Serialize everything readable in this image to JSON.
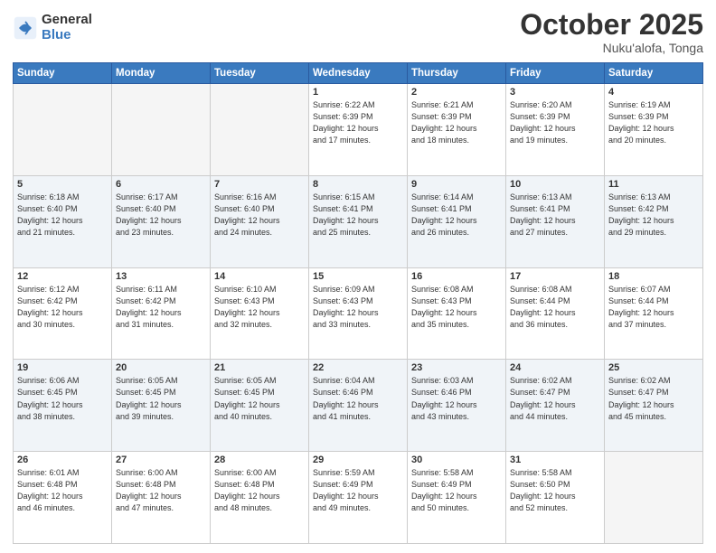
{
  "logo": {
    "general": "General",
    "blue": "Blue"
  },
  "title": "October 2025",
  "location": "Nuku'alofa, Tonga",
  "weekdays": [
    "Sunday",
    "Monday",
    "Tuesday",
    "Wednesday",
    "Thursday",
    "Friday",
    "Saturday"
  ],
  "weeks": [
    [
      {
        "day": "",
        "info": ""
      },
      {
        "day": "",
        "info": ""
      },
      {
        "day": "",
        "info": ""
      },
      {
        "day": "1",
        "info": "Sunrise: 6:22 AM\nSunset: 6:39 PM\nDaylight: 12 hours\nand 17 minutes."
      },
      {
        "day": "2",
        "info": "Sunrise: 6:21 AM\nSunset: 6:39 PM\nDaylight: 12 hours\nand 18 minutes."
      },
      {
        "day": "3",
        "info": "Sunrise: 6:20 AM\nSunset: 6:39 PM\nDaylight: 12 hours\nand 19 minutes."
      },
      {
        "day": "4",
        "info": "Sunrise: 6:19 AM\nSunset: 6:39 PM\nDaylight: 12 hours\nand 20 minutes."
      }
    ],
    [
      {
        "day": "5",
        "info": "Sunrise: 6:18 AM\nSunset: 6:40 PM\nDaylight: 12 hours\nand 21 minutes."
      },
      {
        "day": "6",
        "info": "Sunrise: 6:17 AM\nSunset: 6:40 PM\nDaylight: 12 hours\nand 23 minutes."
      },
      {
        "day": "7",
        "info": "Sunrise: 6:16 AM\nSunset: 6:40 PM\nDaylight: 12 hours\nand 24 minutes."
      },
      {
        "day": "8",
        "info": "Sunrise: 6:15 AM\nSunset: 6:41 PM\nDaylight: 12 hours\nand 25 minutes."
      },
      {
        "day": "9",
        "info": "Sunrise: 6:14 AM\nSunset: 6:41 PM\nDaylight: 12 hours\nand 26 minutes."
      },
      {
        "day": "10",
        "info": "Sunrise: 6:13 AM\nSunset: 6:41 PM\nDaylight: 12 hours\nand 27 minutes."
      },
      {
        "day": "11",
        "info": "Sunrise: 6:13 AM\nSunset: 6:42 PM\nDaylight: 12 hours\nand 29 minutes."
      }
    ],
    [
      {
        "day": "12",
        "info": "Sunrise: 6:12 AM\nSunset: 6:42 PM\nDaylight: 12 hours\nand 30 minutes."
      },
      {
        "day": "13",
        "info": "Sunrise: 6:11 AM\nSunset: 6:42 PM\nDaylight: 12 hours\nand 31 minutes."
      },
      {
        "day": "14",
        "info": "Sunrise: 6:10 AM\nSunset: 6:43 PM\nDaylight: 12 hours\nand 32 minutes."
      },
      {
        "day": "15",
        "info": "Sunrise: 6:09 AM\nSunset: 6:43 PM\nDaylight: 12 hours\nand 33 minutes."
      },
      {
        "day": "16",
        "info": "Sunrise: 6:08 AM\nSunset: 6:43 PM\nDaylight: 12 hours\nand 35 minutes."
      },
      {
        "day": "17",
        "info": "Sunrise: 6:08 AM\nSunset: 6:44 PM\nDaylight: 12 hours\nand 36 minutes."
      },
      {
        "day": "18",
        "info": "Sunrise: 6:07 AM\nSunset: 6:44 PM\nDaylight: 12 hours\nand 37 minutes."
      }
    ],
    [
      {
        "day": "19",
        "info": "Sunrise: 6:06 AM\nSunset: 6:45 PM\nDaylight: 12 hours\nand 38 minutes."
      },
      {
        "day": "20",
        "info": "Sunrise: 6:05 AM\nSunset: 6:45 PM\nDaylight: 12 hours\nand 39 minutes."
      },
      {
        "day": "21",
        "info": "Sunrise: 6:05 AM\nSunset: 6:45 PM\nDaylight: 12 hours\nand 40 minutes."
      },
      {
        "day": "22",
        "info": "Sunrise: 6:04 AM\nSunset: 6:46 PM\nDaylight: 12 hours\nand 41 minutes."
      },
      {
        "day": "23",
        "info": "Sunrise: 6:03 AM\nSunset: 6:46 PM\nDaylight: 12 hours\nand 43 minutes."
      },
      {
        "day": "24",
        "info": "Sunrise: 6:02 AM\nSunset: 6:47 PM\nDaylight: 12 hours\nand 44 minutes."
      },
      {
        "day": "25",
        "info": "Sunrise: 6:02 AM\nSunset: 6:47 PM\nDaylight: 12 hours\nand 45 minutes."
      }
    ],
    [
      {
        "day": "26",
        "info": "Sunrise: 6:01 AM\nSunset: 6:48 PM\nDaylight: 12 hours\nand 46 minutes."
      },
      {
        "day": "27",
        "info": "Sunrise: 6:00 AM\nSunset: 6:48 PM\nDaylight: 12 hours\nand 47 minutes."
      },
      {
        "day": "28",
        "info": "Sunrise: 6:00 AM\nSunset: 6:48 PM\nDaylight: 12 hours\nand 48 minutes."
      },
      {
        "day": "29",
        "info": "Sunrise: 5:59 AM\nSunset: 6:49 PM\nDaylight: 12 hours\nand 49 minutes."
      },
      {
        "day": "30",
        "info": "Sunrise: 5:58 AM\nSunset: 6:49 PM\nDaylight: 12 hours\nand 50 minutes."
      },
      {
        "day": "31",
        "info": "Sunrise: 5:58 AM\nSunset: 6:50 PM\nDaylight: 12 hours\nand 52 minutes."
      },
      {
        "day": "",
        "info": ""
      }
    ]
  ]
}
